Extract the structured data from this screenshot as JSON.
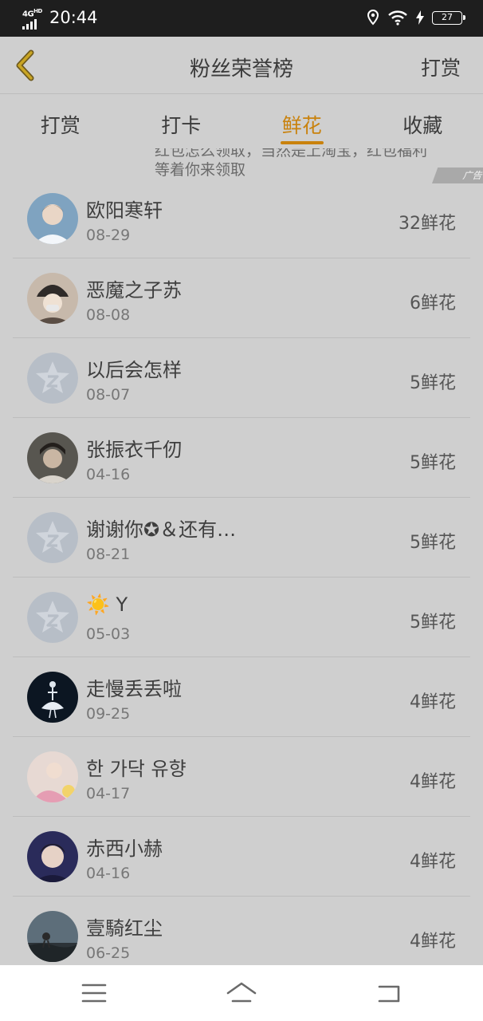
{
  "status_bar": {
    "network": "4G",
    "network_sub": "HD",
    "time": "20:44",
    "battery": "27"
  },
  "nav": {
    "title": "粉丝荣誉榜",
    "action": "打赏"
  },
  "tabs": [
    {
      "label": "打赏",
      "active": false
    },
    {
      "label": "打卡",
      "active": false
    },
    {
      "label": "鲜花",
      "active": true
    },
    {
      "label": "收藏",
      "active": false
    }
  ],
  "ad": {
    "line1": "红包怎么领取，当然是上淘宝，红包福利",
    "line2": "等着你来领取",
    "tag": "广告"
  },
  "rows": [
    {
      "name": "欧阳寒轩",
      "date": "08-29",
      "count": "32鲜花"
    },
    {
      "name": "恶魔之子苏",
      "date": "08-08",
      "count": "6鲜花"
    },
    {
      "name": "以后会怎样",
      "date": "08-07",
      "count": "5鲜花"
    },
    {
      "name": "张振衣千仞",
      "date": "04-16",
      "count": "5鲜花"
    },
    {
      "name": "谢谢你✪＆还有…",
      "date": "08-21",
      "count": "5鲜花"
    },
    {
      "name": "☀️ Y",
      "date": "05-03",
      "count": "5鲜花"
    },
    {
      "name": "走慢丢丢啦",
      "date": "09-25",
      "count": "4鲜花"
    },
    {
      "name": "한 가닥 유향",
      "date": "04-17",
      "count": "4鲜花"
    },
    {
      "name": "赤西小赫",
      "date": "04-16",
      "count": "4鲜花"
    },
    {
      "name": "壹騎红尘",
      "date": "06-25",
      "count": "4鲜花"
    }
  ],
  "colors": {
    "accent": "#c9820d",
    "overlay_bg": "#cfcfcf",
    "status_bar": "#1e1e1e"
  }
}
